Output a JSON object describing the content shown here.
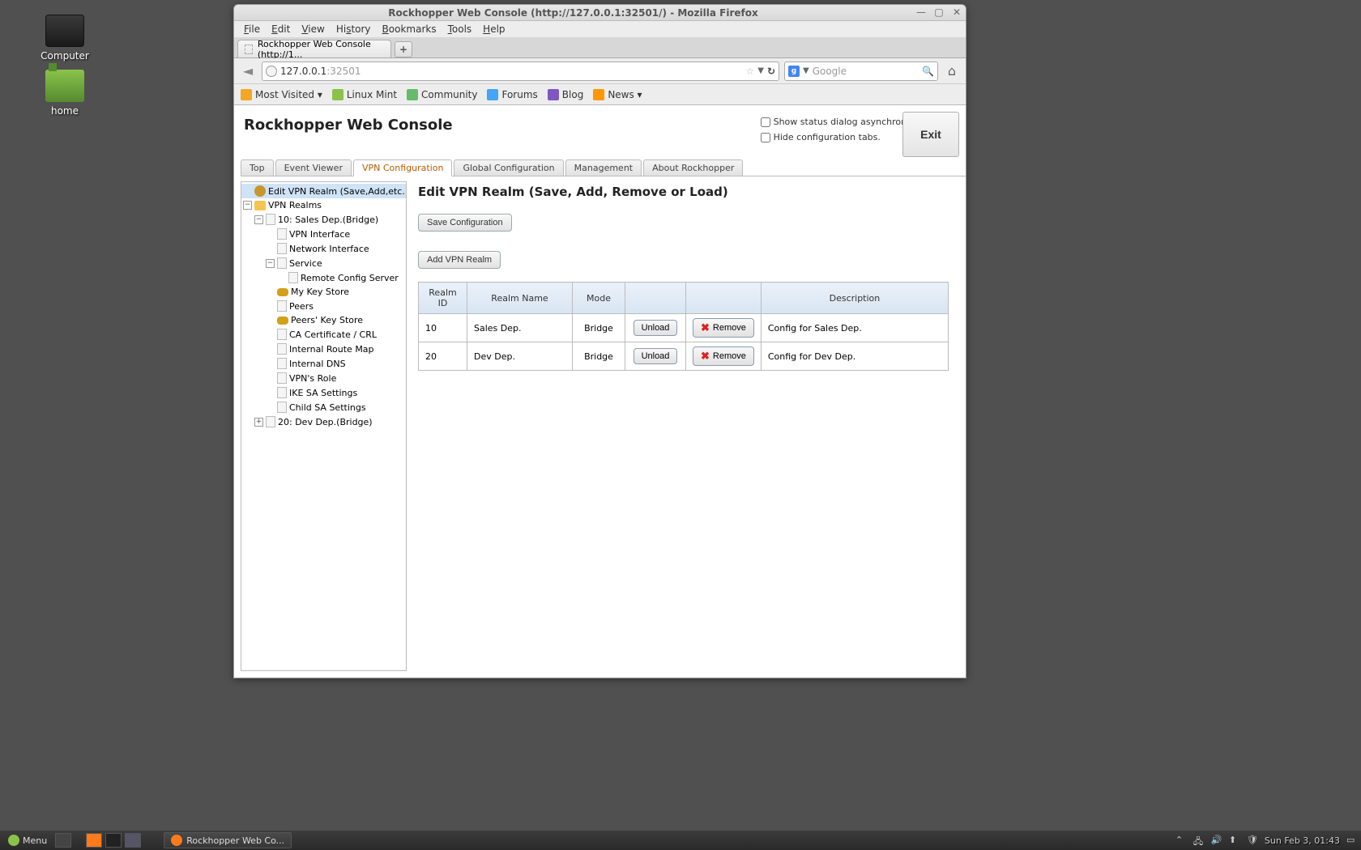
{
  "desktop": {
    "computer": "Computer",
    "home": "home"
  },
  "window": {
    "title": "Rockhopper Web Console (http://127.0.0.1:32501/) - Mozilla Firefox"
  },
  "menubar": [
    "File",
    "Edit",
    "View",
    "History",
    "Bookmarks",
    "Tools",
    "Help"
  ],
  "tab": {
    "label": "Rockhopper Web Console (http://1..."
  },
  "url": {
    "host": "127.0.0.1",
    "port": ":32501"
  },
  "search": {
    "placeholder": "Google"
  },
  "bookmarks": {
    "mostvisited": "Most Visited ▾",
    "mint": "Linux Mint",
    "community": "Community",
    "forums": "Forums",
    "blog": "Blog",
    "news": "News ▾"
  },
  "app": {
    "title": "Rockhopper Web Console",
    "chk_async": "Show status dialog asynchronously.",
    "chk_hide": "Hide configuration tabs.",
    "exit": "Exit"
  },
  "tabs": {
    "top": "Top",
    "event": "Event Viewer",
    "vpn": "VPN Configuration",
    "global": "Global Configuration",
    "mgmt": "Management",
    "about": "About Rockhopper"
  },
  "tree": {
    "edit": "Edit VPN Realm (Save,Add,etc.)",
    "realms": "VPN Realms",
    "r10": "10: Sales Dep.(Bridge)",
    "vpnif": "VPN Interface",
    "netif": "Network Interface",
    "service": "Service",
    "rcs": "Remote Config Server",
    "mykey": "My Key Store",
    "peers": "Peers",
    "peerskey": "Peers' Key Store",
    "cacrl": "CA Certificate / CRL",
    "irm": "Internal Route Map",
    "idns": "Internal DNS",
    "role": "VPN's Role",
    "ike": "IKE SA Settings",
    "child": "Child SA Settings",
    "r20": "20: Dev Dep.(Bridge)"
  },
  "main": {
    "heading": "Edit VPN Realm (Save, Add, Remove or Load)",
    "save_btn": "Save Configuration",
    "add_btn": "Add VPN Realm",
    "th_id": "Realm ID",
    "th_name": "Realm Name",
    "th_mode": "Mode",
    "th_desc": "Description",
    "unload": "Unload",
    "remove": "Remove",
    "rows": [
      {
        "id": "10",
        "name": "Sales Dep.",
        "mode": "Bridge",
        "desc": "Config for Sales Dep."
      },
      {
        "id": "20",
        "name": "Dev Dep.",
        "mode": "Bridge",
        "desc": "Config for Dev Dep."
      }
    ]
  },
  "taskbar": {
    "menu": "Menu",
    "task": "Rockhopper Web Co...",
    "clock": "Sun Feb  3, 01:43"
  }
}
